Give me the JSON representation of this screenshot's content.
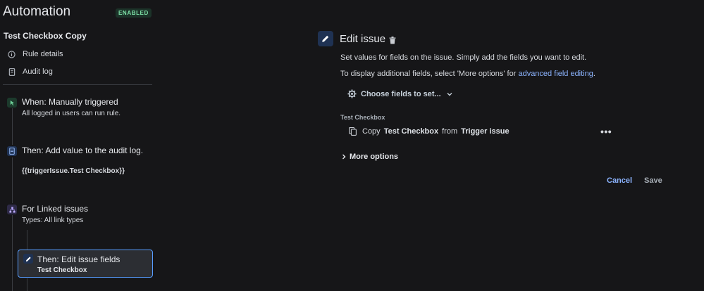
{
  "header": {
    "title": "Automation",
    "status_badge": "ENABLED"
  },
  "rule": {
    "name": "Test Checkbox Copy"
  },
  "nav": {
    "rule_details": "Rule details",
    "audit_log": "Audit log"
  },
  "steps": [
    {
      "title": "When: Manually triggered",
      "subtitle": "All logged in users can run rule."
    },
    {
      "title": "Then: Add value to the audit log.",
      "subtitle": "{{triggerIssue.Test Checkbox}}"
    },
    {
      "title": "For Linked issues",
      "subtitle": "Types: All link types"
    },
    {
      "title": "Then: Edit issue fields",
      "subtitle": "Test Checkbox"
    }
  ],
  "panel": {
    "title": "Edit issue",
    "description": "Set values for fields on the issue. Simply add the fields you want to edit.",
    "additional_prefix": "To display additional fields, select 'More options' for ",
    "additional_link": "advanced field editing",
    "additional_suffix": ".",
    "choose_fields": "Choose fields to set...",
    "field_label": "Test Checkbox",
    "copy_word": "Copy",
    "copy_field": "Test Checkbox",
    "copy_from": "from",
    "copy_source": "Trigger issue",
    "more_dots": "•••",
    "more_options": "More options",
    "cancel": "Cancel",
    "save": "Save"
  },
  "icons": {
    "info": "info-circle-icon",
    "audit": "document-icon",
    "trigger": "cursor-click-icon",
    "branch": "hierarchy-icon",
    "edit": "pencil-icon",
    "trash": "trash-icon",
    "gear": "gear-icon",
    "chevron_down": "chevron-down-icon",
    "chevron_right": "chevron-right-icon",
    "copy": "copy-icon"
  },
  "colors": {
    "accent": "#579dff",
    "link": "#8cb4ff",
    "badge_text": "#7ee2a8",
    "badge_bg": "#1c3329"
  }
}
